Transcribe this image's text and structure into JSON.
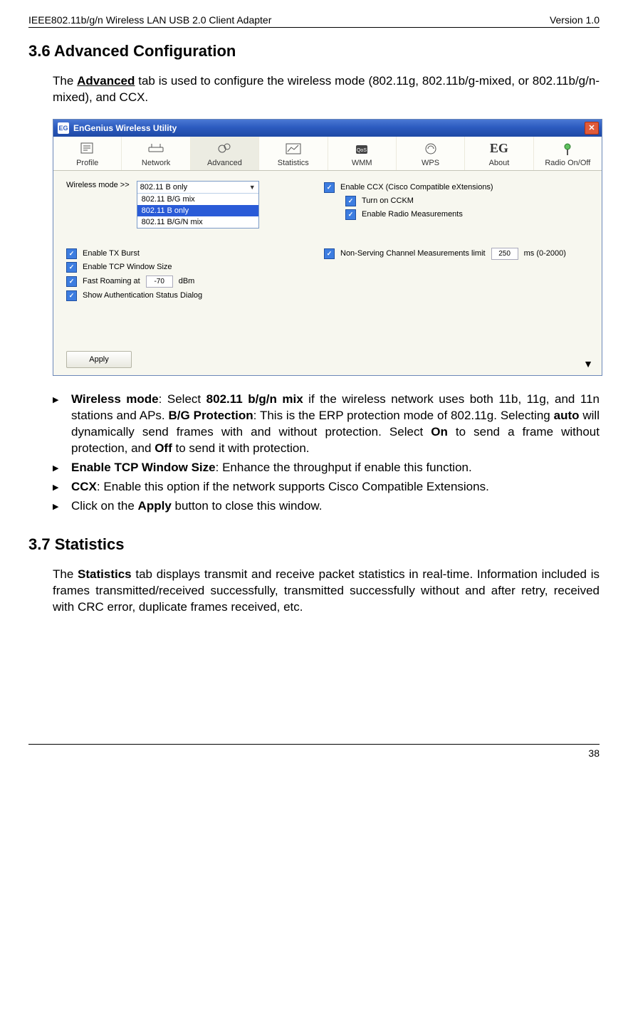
{
  "header": {
    "left": "IEEE802.11b/g/n Wireless LAN USB 2.0 Client Adapter",
    "right": "Version 1.0"
  },
  "section36": {
    "heading": "3.6  Advanced Configuration",
    "intro_pre": "The ",
    "intro_bold": "Advanced",
    "intro_post": " tab is used to configure the wireless mode (802.11g, 802.11b/g-mixed, or 802.11b/g/n-mixed), and CCX."
  },
  "app": {
    "title": "EnGenius Wireless Utility",
    "logo": "EG",
    "tabs": [
      {
        "label": "Profile",
        "name": "tab-profile"
      },
      {
        "label": "Network",
        "name": "tab-network"
      },
      {
        "label": "Advanced",
        "name": "tab-advanced"
      },
      {
        "label": "Statistics",
        "name": "tab-statistics"
      },
      {
        "label": "WMM",
        "name": "tab-wmm"
      },
      {
        "label": "WPS",
        "name": "tab-wps"
      },
      {
        "label": "About",
        "name": "tab-about"
      },
      {
        "label": "Radio On/Off",
        "name": "tab-radio"
      }
    ],
    "wireless_mode_label": "Wireless mode >>",
    "wireless_select_current": "802.11 B only",
    "wireless_options": [
      "802.11 B/G mix",
      "802.11 B only",
      "802.11 B/G/N mix"
    ],
    "enable_ccx": "Enable CCX (Cisco Compatible eXtensions)",
    "turn_on_cckm": "Turn on CCKM",
    "enable_radio_meas": "Enable Radio Measurements",
    "nscm_label": "Non-Serving Channel Measurements limit",
    "nscm_value": "250",
    "nscm_suffix": "ms (0-2000)",
    "enable_tx_burst": "Enable TX Burst",
    "enable_tcp_win": "Enable TCP Window Size",
    "fast_roaming_pre": "Fast Roaming at",
    "fast_roaming_val": "-70",
    "fast_roaming_suf": "dBm",
    "show_auth": "Show Authentication Status Dialog",
    "apply": "Apply"
  },
  "bullets": {
    "b1_wm_label": "Wireless mode",
    "b1_part1": ": Select ",
    "b1_mix": "802.11 b/g/n mix",
    "b1_part2": " if the wireless network uses both 11b, 11g, and 11n stations and APs. ",
    "b1_bgp": "B/G Protection",
    "b1_part3": ": This is the ERP protection mode of 802.11g. Selecting ",
    "b1_auto": "auto",
    "b1_part4": " will dynamically send frames with and without protection. Select ",
    "b1_on": "On",
    "b1_part5": " to send a frame without protection, and ",
    "b1_off": "Off",
    "b1_part6": " to send it with protection.",
    "b2_label": "Enable TCP Window Size",
    "b2_text": ": Enhance the throughput if enable this function.",
    "b3_label": "CCX",
    "b3_text": ": Enable this option if the network supports Cisco Compatible Extensions.",
    "b4_pre": "Click on the ",
    "b4_apply": "Apply",
    "b4_post": " button to close this window."
  },
  "section37": {
    "heading": "3.7  Statistics",
    "body_pre": "The ",
    "body_bold": "Statistics",
    "body_post": " tab displays transmit and receive packet statistics in real-time. Information included is frames transmitted/received successfully, transmitted successfully without and after retry, received with CRC error, duplicate frames received, etc."
  },
  "footer": {
    "page": "38"
  }
}
